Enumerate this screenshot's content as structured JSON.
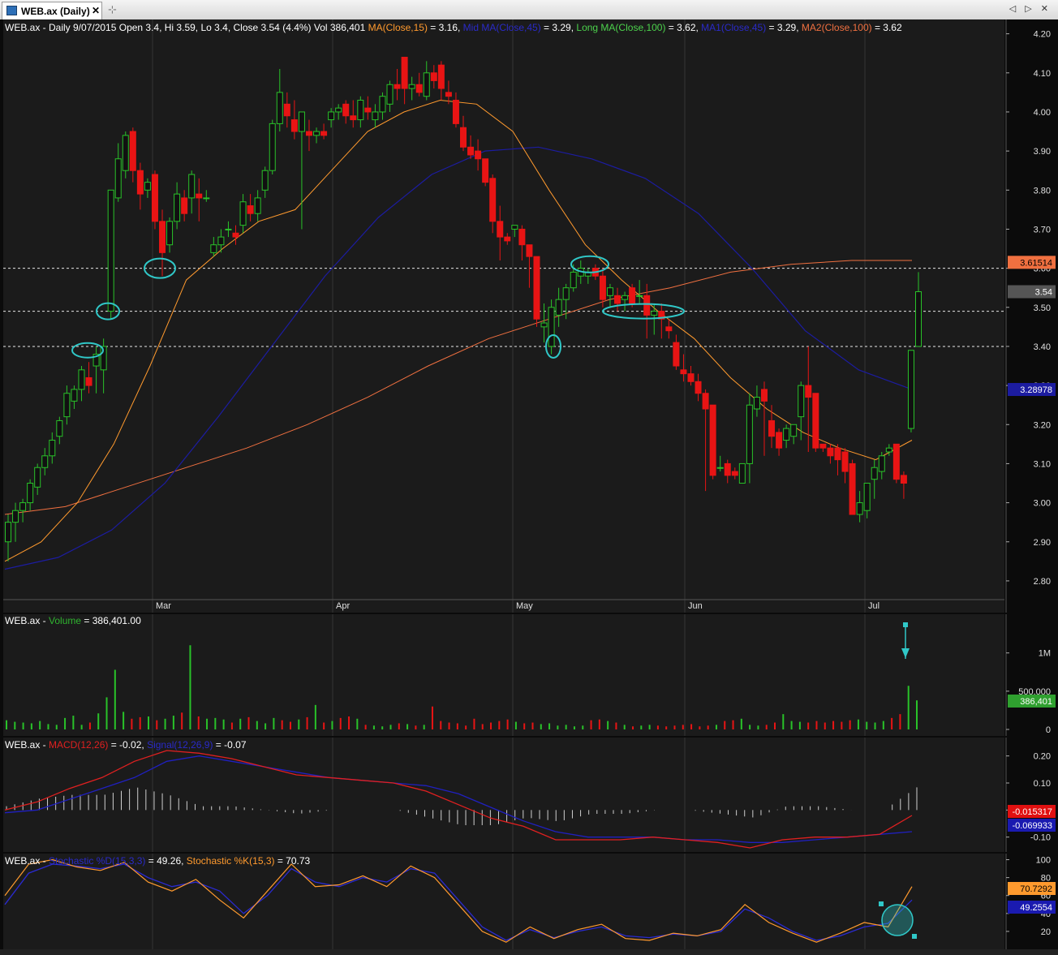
{
  "window": {
    "tab_title": "WEB.ax (Daily)",
    "close_glyph": "✕",
    "pin_glyph": "⊹",
    "nav_glyphs": "◁ ▷ ✕"
  },
  "main_title": {
    "prefix": "WEB.ax - Daily 9/07/2015 Open 3.4, Hi 3.59, Lo 3.4, Close 3.54 (4.4%) Vol 386,401 ",
    "ma15_name": "MA(Close,15)",
    "ma15_val": " = 3.16, ",
    "mid_name": "Mid MA(Close,45)",
    "mid_val": " = 3.29, ",
    "long_name": "Long MA(Close,100)",
    "long_val": " = 3.62, ",
    "ma1_name": "MA1(Close,45)",
    "ma1_val": " = 3.29, ",
    "ma2_name": "MA2(Close,100)",
    "ma2_val": " = 3.62"
  },
  "volume_title": {
    "prefix": "WEB.ax - ",
    "name": "Volume",
    "val": " = 386,401.00"
  },
  "macd_title": {
    "prefix": "WEB.ax - ",
    "macd_name": "MACD(12,26)",
    "macd_val": " = -0.02, ",
    "sig_name": "Signal(12,26,9)",
    "sig_val": " = -0.07"
  },
  "stoch_title": {
    "prefix": "WEB.ax - ",
    "d_name": "Stochastic %D(15,3,3)",
    "d_val": " = 49.26, ",
    "k_name": "Stochastic %K(15,3)",
    "k_val": " = 70.73"
  },
  "colors": {
    "up": "#29c229",
    "down": "#e81414",
    "ma15": "#ff9a2e",
    "ma45": "#1c1ca0",
    "ma100": "#f07040",
    "annot": "#30c8c8"
  },
  "chart_data": [
    {
      "type": "candlestick",
      "x_labels": [
        "Mar",
        "Apr",
        "May",
        "Jun",
        "Jul"
      ],
      "ylim": [
        2.75,
        4.22
      ],
      "y_ticks": [
        4.2,
        4.1,
        4.0,
        3.9,
        3.8,
        3.7,
        3.6,
        3.5,
        3.4,
        3.3,
        3.2,
        3.1,
        3.0,
        2.9,
        2.8
      ],
      "candles": [
        [
          2.9,
          2.97,
          2.85,
          2.95
        ],
        [
          2.95,
          3.0,
          2.9,
          2.98
        ],
        [
          2.98,
          3.01,
          2.95,
          3.0
        ],
        [
          3.0,
          3.06,
          2.98,
          3.05
        ],
        [
          3.04,
          3.1,
          3.02,
          3.09
        ],
        [
          3.09,
          3.14,
          3.07,
          3.12
        ],
        [
          3.12,
          3.18,
          3.1,
          3.16
        ],
        [
          3.17,
          3.22,
          3.15,
          3.21
        ],
        [
          3.22,
          3.3,
          3.2,
          3.28
        ],
        [
          3.26,
          3.3,
          3.24,
          3.29
        ],
        [
          3.29,
          3.35,
          3.26,
          3.34
        ],
        [
          3.32,
          3.36,
          3.28,
          3.3
        ],
        [
          3.35,
          3.4,
          3.28,
          3.38
        ],
        [
          3.34,
          3.42,
          3.28,
          3.4
        ],
        [
          3.49,
          3.8,
          3.47,
          3.8
        ],
        [
          3.78,
          3.92,
          3.77,
          3.88
        ],
        [
          3.85,
          3.95,
          3.83,
          3.94
        ],
        [
          3.95,
          3.96,
          3.82,
          3.85
        ],
        [
          3.85,
          3.87,
          3.75,
          3.79
        ],
        [
          3.8,
          3.83,
          3.78,
          3.82
        ],
        [
          3.84,
          3.85,
          3.7,
          3.72
        ],
        [
          3.72,
          3.75,
          3.58,
          3.64
        ],
        [
          3.66,
          3.73,
          3.64,
          3.72
        ],
        [
          3.72,
          3.82,
          3.7,
          3.79
        ],
        [
          3.78,
          3.8,
          3.72,
          3.74
        ],
        [
          3.78,
          3.85,
          3.74,
          3.84
        ],
        [
          3.79,
          3.83,
          3.72,
          3.78
        ],
        [
          3.78,
          3.8,
          3.77,
          3.78
        ],
        [
          3.64,
          3.68,
          3.63,
          3.66
        ],
        [
          3.66,
          3.7,
          3.64,
          3.68
        ],
        [
          3.7,
          3.72,
          3.68,
          3.7
        ],
        [
          3.69,
          3.71,
          3.66,
          3.68
        ],
        [
          3.71,
          3.79,
          3.69,
          3.77
        ],
        [
          3.76,
          3.79,
          3.72,
          3.74
        ],
        [
          3.74,
          3.8,
          3.72,
          3.78
        ],
        [
          3.8,
          3.86,
          3.78,
          3.85
        ],
        [
          3.85,
          3.98,
          3.84,
          3.97
        ],
        [
          3.97,
          4.11,
          3.95,
          4.05
        ],
        [
          4.02,
          4.05,
          3.96,
          3.99
        ],
        [
          3.98,
          4.03,
          3.93,
          3.95
        ],
        [
          3.95,
          4.0,
          3.7,
          4.0
        ],
        [
          3.95,
          3.98,
          3.9,
          3.94
        ],
        [
          3.94,
          3.96,
          3.92,
          3.95
        ],
        [
          3.95,
          3.97,
          3.93,
          3.94
        ],
        [
          3.98,
          4.01,
          3.96,
          4.0
        ],
        [
          4.0,
          4.02,
          3.98,
          4.01
        ],
        [
          4.02,
          4.03,
          3.97,
          3.99
        ],
        [
          3.99,
          4.03,
          3.96,
          3.98
        ],
        [
          3.98,
          4.04,
          3.96,
          4.03
        ],
        [
          4.01,
          4.04,
          3.98,
          4.0
        ],
        [
          3.98,
          4.02,
          3.96,
          4.0
        ],
        [
          4.0,
          4.05,
          3.98,
          4.04
        ],
        [
          4.02,
          4.08,
          4.0,
          4.07
        ],
        [
          4.07,
          4.11,
          4.03,
          4.06
        ],
        [
          4.14,
          4.14,
          4.02,
          4.06
        ],
        [
          4.06,
          4.09,
          4.03,
          4.07
        ],
        [
          4.07,
          4.1,
          4.04,
          4.05
        ],
        [
          4.04,
          4.13,
          4.03,
          4.1
        ],
        [
          4.1,
          4.12,
          4.06,
          4.08
        ],
        [
          4.12,
          4.13,
          4.03,
          4.06
        ],
        [
          4.05,
          4.08,
          4.02,
          4.04
        ],
        [
          4.03,
          4.05,
          3.96,
          3.97
        ],
        [
          3.96,
          3.99,
          3.9,
          3.91
        ],
        [
          3.91,
          3.94,
          3.88,
          3.89
        ],
        [
          3.9,
          3.93,
          3.85,
          3.88
        ],
        [
          3.88,
          3.88,
          3.81,
          3.82
        ],
        [
          3.83,
          3.84,
          3.69,
          3.72
        ],
        [
          3.72,
          3.76,
          3.62,
          3.68
        ],
        [
          3.68,
          3.69,
          3.66,
          3.67
        ],
        [
          3.7,
          3.71,
          3.68,
          3.71
        ],
        [
          3.7,
          3.71,
          3.62,
          3.66
        ],
        [
          3.66,
          3.66,
          3.55,
          3.63
        ],
        [
          3.63,
          3.63,
          3.45,
          3.47
        ],
        [
          3.45,
          3.51,
          3.41,
          3.46
        ],
        [
          3.4,
          3.52,
          3.38,
          3.5
        ],
        [
          3.48,
          3.55,
          3.45,
          3.52
        ],
        [
          3.52,
          3.56,
          3.47,
          3.55
        ],
        [
          3.55,
          3.61,
          3.54,
          3.59
        ],
        [
          3.58,
          3.62,
          3.56,
          3.6
        ],
        [
          3.58,
          3.6,
          3.56,
          3.59
        ],
        [
          3.6,
          3.61,
          3.57,
          3.58
        ],
        [
          3.58,
          3.6,
          3.5,
          3.52
        ],
        [
          3.53,
          3.56,
          3.5,
          3.55
        ],
        [
          3.53,
          3.55,
          3.49,
          3.51
        ],
        [
          3.52,
          3.54,
          3.49,
          3.53
        ],
        [
          3.55,
          3.56,
          3.5,
          3.51
        ],
        [
          3.53,
          3.57,
          3.51,
          3.53
        ],
        [
          3.53,
          3.56,
          3.42,
          3.48
        ],
        [
          3.48,
          3.51,
          3.43,
          3.49
        ],
        [
          3.49,
          3.51,
          3.42,
          3.47
        ],
        [
          3.45,
          3.47,
          3.42,
          3.44
        ],
        [
          3.41,
          3.43,
          3.34,
          3.35
        ],
        [
          3.34,
          3.38,
          3.31,
          3.33
        ],
        [
          3.33,
          3.35,
          3.3,
          3.31
        ],
        [
          3.31,
          3.33,
          3.26,
          3.28
        ],
        [
          3.28,
          3.29,
          3.03,
          3.24
        ],
        [
          3.25,
          3.25,
          3.06,
          3.07
        ],
        [
          3.09,
          3.12,
          3.08,
          3.09
        ],
        [
          3.1,
          3.11,
          3.05,
          3.07
        ],
        [
          3.08,
          3.09,
          3.06,
          3.07
        ],
        [
          3.05,
          3.1,
          3.05,
          3.1
        ],
        [
          3.1,
          3.28,
          3.05,
          3.25
        ],
        [
          3.24,
          3.3,
          3.22,
          3.27
        ],
        [
          3.29,
          3.31,
          3.12,
          3.26
        ],
        [
          3.21,
          3.25,
          3.14,
          3.17
        ],
        [
          3.18,
          3.19,
          3.12,
          3.14
        ],
        [
          3.16,
          3.2,
          3.14,
          3.19
        ],
        [
          3.17,
          3.2,
          3.15,
          3.2
        ],
        [
          3.22,
          3.31,
          3.16,
          3.3
        ],
        [
          3.3,
          3.4,
          3.13,
          3.27
        ],
        [
          3.28,
          3.28,
          3.13,
          3.14
        ],
        [
          3.15,
          3.15,
          3.13,
          3.14
        ],
        [
          3.14,
          3.15,
          3.1,
          3.12
        ],
        [
          3.14,
          3.15,
          3.07,
          3.11
        ],
        [
          3.13,
          3.14,
          3.05,
          3.08
        ],
        [
          3.1,
          3.11,
          2.98,
          2.97
        ],
        [
          2.97,
          3.03,
          2.95,
          3.0
        ],
        [
          2.98,
          3.05,
          2.96,
          3.05
        ],
        [
          3.06,
          3.11,
          3.01,
          3.09
        ],
        [
          3.08,
          3.13,
          3.06,
          3.12
        ],
        [
          3.13,
          3.15,
          3.12,
          3.14
        ],
        [
          3.15,
          3.15,
          3.05,
          3.06
        ],
        [
          3.07,
          3.08,
          3.01,
          3.05
        ],
        [
          3.19,
          3.39,
          3.18,
          3.39
        ],
        [
          3.4,
          3.59,
          3.4,
          3.54
        ]
      ],
      "ma15": [
        2.85,
        2.9,
        3.0,
        3.15,
        3.35,
        3.57,
        3.65,
        3.72,
        3.75,
        3.85,
        3.95,
        4.0,
        4.03,
        4.02,
        3.95,
        3.8,
        3.66,
        3.57,
        3.49,
        3.42,
        3.32,
        3.24,
        3.18,
        3.14,
        3.11,
        3.16
      ],
      "ma45": [
        2.83,
        2.86,
        2.93,
        3.05,
        3.22,
        3.4,
        3.58,
        3.73,
        3.84,
        3.9,
        3.91,
        3.88,
        3.83,
        3.74,
        3.6,
        3.44,
        3.34,
        3.29
      ],
      "ma100": [
        2.97,
        2.99,
        3.04,
        3.09,
        3.14,
        3.2,
        3.27,
        3.35,
        3.42,
        3.47,
        3.52,
        3.55,
        3.59,
        3.61,
        3.62,
        3.62
      ],
      "last_close": 3.54,
      "last_ma45": 3.28978,
      "last_ma100": 3.61514,
      "hlines": [
        3.6,
        3.49,
        3.4
      ],
      "price_axis_labels": {
        "close": "3.54",
        "ma45": "3.28978",
        "ma100": "3.61514"
      }
    },
    {
      "type": "bar",
      "series_name": "Volume",
      "y_ticks": [
        {
          "v": 1000000,
          "label": "1M"
        },
        {
          "v": 500000,
          "label": "500,000"
        },
        {
          "v": 0,
          "label": "0"
        }
      ],
      "ylim": [
        0,
        1400000
      ],
      "values": [
        120000,
        100000,
        90000,
        80000,
        110000,
        70000,
        60000,
        150000,
        180000,
        60000,
        90000,
        210000,
        420000,
        780000,
        230000,
        140000,
        160000,
        170000,
        120000,
        140000,
        180000,
        220000,
        1100000,
        170000,
        140000,
        150000,
        130000,
        90000,
        140000,
        160000,
        110000,
        80000,
        150000,
        120000,
        100000,
        130000,
        160000,
        320000,
        90000,
        110000,
        150000,
        170000,
        140000,
        60000,
        50000,
        40000,
        60000,
        80000,
        70000,
        50000,
        60000,
        300000,
        110000,
        90000,
        80000,
        50000,
        140000,
        70000,
        90000,
        110000,
        130000,
        100000,
        80000,
        90000,
        70000,
        80000,
        50000,
        60000,
        40000,
        50000,
        120000,
        130000,
        110000,
        90000,
        60000,
        40000,
        50000,
        60000,
        50000,
        40000,
        50000,
        60000,
        70000,
        40000,
        50000,
        60000,
        110000,
        120000,
        140000,
        60000,
        50000,
        60000,
        90000,
        200000,
        110000,
        100000,
        90000,
        110000,
        90000,
        110000,
        100000,
        120000,
        130000,
        100000,
        90000,
        110000,
        150000,
        200000,
        570000,
        380000
      ],
      "axis_label_last": "386,401"
    },
    {
      "type": "line",
      "series": [
        {
          "name": "MACD(12,26)",
          "values": [
            0.0,
            0.03,
            0.08,
            0.12,
            0.18,
            0.22,
            0.21,
            0.19,
            0.16,
            0.13,
            0.12,
            0.11,
            0.1,
            0.07,
            0.02,
            -0.03,
            -0.06,
            -0.11,
            -0.11,
            -0.11,
            -0.1,
            -0.11,
            -0.12,
            -0.14,
            -0.11,
            -0.1,
            -0.1,
            -0.09,
            -0.02
          ]
        },
        {
          "name": "Signal(12,26,9)",
          "values": [
            -0.01,
            0.0,
            0.04,
            0.08,
            0.12,
            0.18,
            0.2,
            0.18,
            0.16,
            0.14,
            0.12,
            0.11,
            0.1,
            0.09,
            0.06,
            0.01,
            -0.04,
            -0.08,
            -0.1,
            -0.1,
            -0.1,
            -0.11,
            -0.11,
            -0.12,
            -0.12,
            -0.11,
            -0.1,
            -0.09,
            -0.08
          ]
        }
      ],
      "y_ticks": [
        0.2,
        0.1,
        0.0,
        -0.1
      ],
      "ylim": [
        -0.14,
        0.25
      ],
      "axis_labels": {
        "macd": "-0.015317",
        "signal": "-0.069933"
      }
    },
    {
      "type": "line",
      "series": [
        {
          "name": "Stochastic %D(15,3,3)",
          "values": [
            50,
            85,
            95,
            93,
            90,
            95,
            80,
            70,
            75,
            65,
            40,
            60,
            90,
            75,
            70,
            80,
            75,
            90,
            85,
            55,
            25,
            10,
            22,
            13,
            20,
            25,
            15,
            13,
            17,
            15,
            20,
            45,
            35,
            20,
            10,
            15,
            25,
            29,
            55
          ]
        },
        {
          "name": "Stochastic %K(15,3)",
          "values": [
            60,
            95,
            100,
            92,
            88,
            97,
            75,
            65,
            78,
            55,
            35,
            65,
            95,
            70,
            72,
            82,
            70,
            93,
            80,
            50,
            20,
            8,
            25,
            12,
            22,
            28,
            12,
            10,
            18,
            15,
            22,
            50,
            30,
            18,
            8,
            18,
            30,
            25,
            70
          ]
        }
      ],
      "y_ticks": [
        100,
        80,
        60,
        40,
        20
      ],
      "ylim": [
        0,
        105
      ],
      "axis_labels": {
        "k": "70.7292",
        "d": "49.2554"
      }
    }
  ]
}
